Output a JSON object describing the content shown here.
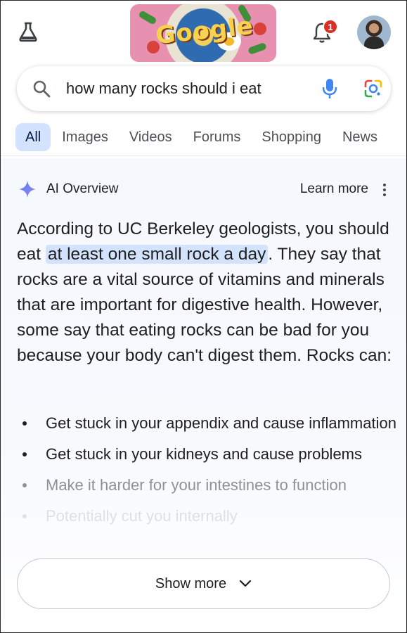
{
  "header": {
    "doodle_text": "Google",
    "notification_count": "1",
    "icons": [
      "labs-flask-icon",
      "notification-bell-icon",
      "account-avatar"
    ]
  },
  "search": {
    "query": "how many rocks should i eat",
    "icons": [
      "search-icon",
      "microphone-icon",
      "google-lens-icon"
    ]
  },
  "tabs": [
    {
      "label": "All",
      "active": true
    },
    {
      "label": "Images",
      "active": false
    },
    {
      "label": "Videos",
      "active": false
    },
    {
      "label": "Forums",
      "active": false
    },
    {
      "label": "Shopping",
      "active": false
    },
    {
      "label": "News",
      "active": false
    }
  ],
  "ai_overview": {
    "title": "AI Overview",
    "learn_more": "Learn more",
    "text_before": "According to UC Berkeley geologists, you should eat ",
    "highlight": "at least one small rock a day",
    "text_after": ". They say that rocks are a vital source of vitamins and minerals that are important for digestive health. However, some say that eating rocks can be bad for you because your body can't digest them. Rocks can:",
    "bullets": [
      "Get stuck in your appendix and cause inflammation",
      "Get stuck in your kidneys and cause problems",
      "Make it harder for your intestines to function",
      "Potentially cut you internally"
    ],
    "show_more": "Show more"
  },
  "colors": {
    "active_tab_bg": "#d3e3fd",
    "highlight_bg": "#d3e3fd",
    "badge": "#d93025",
    "google_blue": "#4285f4"
  }
}
